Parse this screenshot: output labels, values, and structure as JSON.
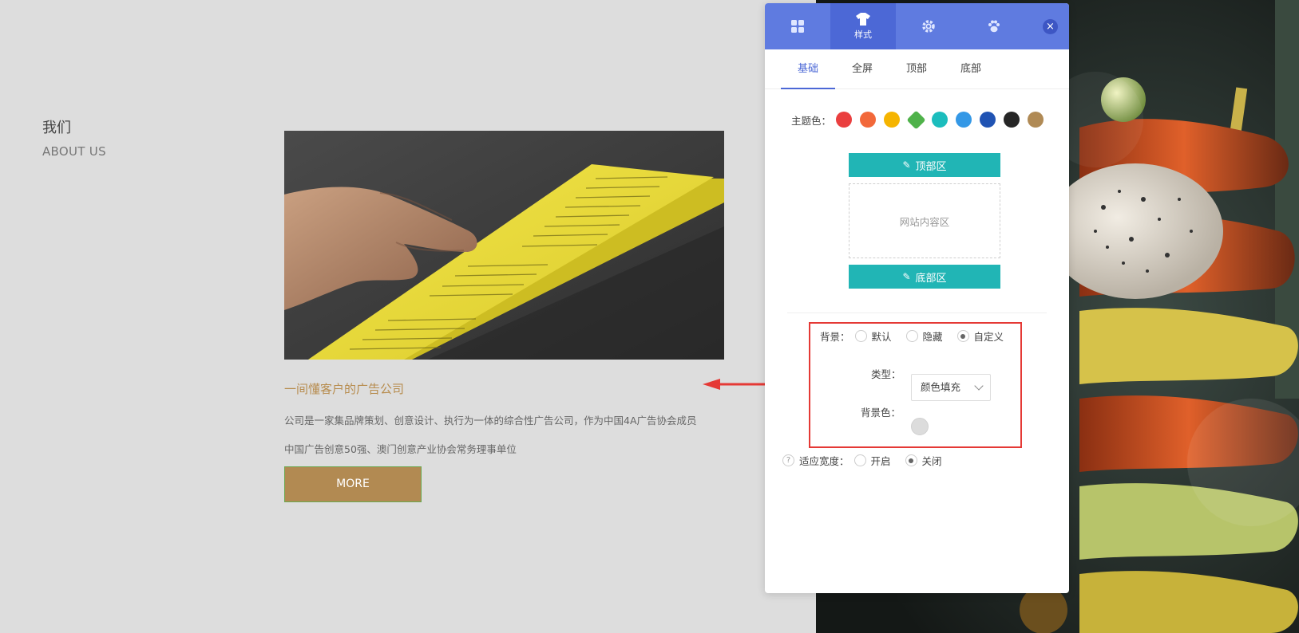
{
  "about": {
    "title": "我们",
    "subtitle": "ABOUT US",
    "headline": "一间懂客户的广告公司",
    "desc_line1": "公司是一家集品牌策划、创意设计、执行为一体的综合性广告公司，作为中国4A广告协会成员",
    "desc_line2": "中国广告创意50强、澳门创意产业协会常务理事单位",
    "more_label": "MORE"
  },
  "panel": {
    "top_tabs": [
      {
        "icon": "grid-icon",
        "label": ""
      },
      {
        "icon": "shirt-icon",
        "label": "样式"
      },
      {
        "icon": "gear-icon",
        "label": ""
      },
      {
        "icon": "paw-icon",
        "label": ""
      }
    ],
    "close_icon": "close-icon",
    "sub_tabs": [
      "基础",
      "全屏",
      "顶部",
      "底部"
    ],
    "theme_label": "主题色：",
    "theme_colors": [
      "#ea3f3f",
      "#f2683a",
      "#f5b400",
      "#4fb24a",
      "#1cbdbd",
      "#3498e6",
      "#2053b3",
      "#262626",
      "#b08a55"
    ],
    "top_zone_label": "顶部区",
    "content_zone_label": "网站内容区",
    "bottom_zone_label": "底部区",
    "background_label": "背景：",
    "background_options": [
      "默认",
      "隐藏",
      "自定义"
    ],
    "background_selected": "自定义",
    "type_label": "类型：",
    "type_value": "颜色填充",
    "bg_color_label": "背景色：",
    "bg_color_value": "#dcdcdc",
    "adaptive_label": "适应宽度：",
    "adaptive_options": [
      "开启",
      "关闭"
    ],
    "adaptive_selected": "关闭"
  },
  "colors": {
    "panel_header": "#5f7be0",
    "panel_header_active": "#4c68d6",
    "zone_button": "#21b5b5",
    "highlight_border": "#e53935",
    "more_button": "#b28a52",
    "headline": "#b78c4e"
  }
}
